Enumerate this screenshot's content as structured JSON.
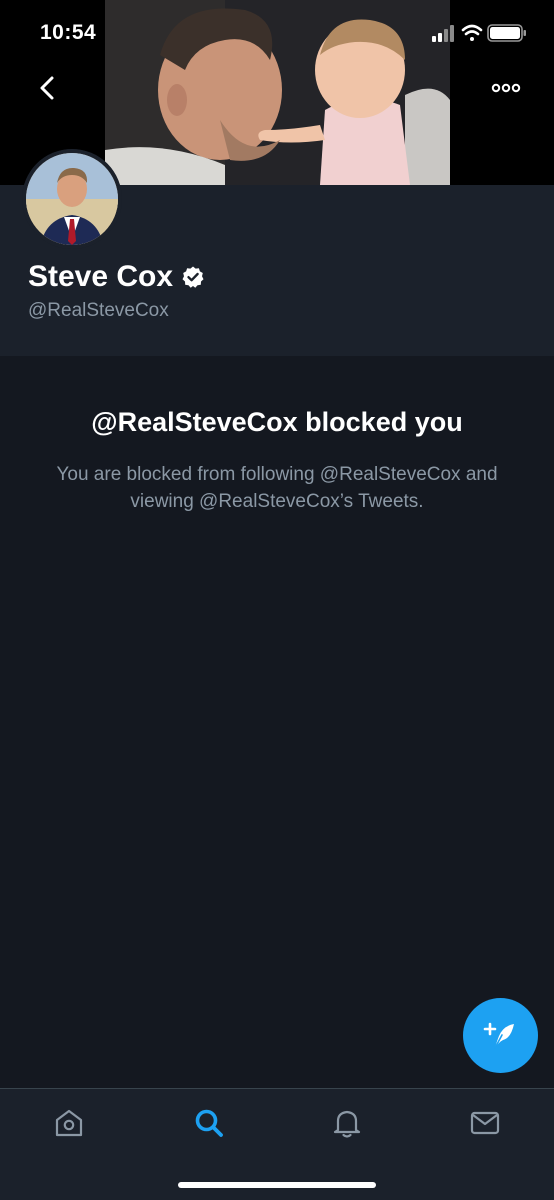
{
  "status_bar": {
    "time": "10:54"
  },
  "header": {
    "back_icon": "chevron-left-icon",
    "more_icon": "more-horizontal-icon"
  },
  "profile": {
    "display_name": "Steve Cox",
    "handle": "@RealSteveCox",
    "verified": true
  },
  "blocked": {
    "title": "@RealSteveCox blocked you",
    "description": "You are blocked from following @RealSteveCox and viewing @RealSteveCox’s Tweets."
  },
  "fab": {
    "icon": "compose-tweet-icon"
  },
  "tabbar": {
    "tabs": [
      {
        "name": "home",
        "icon": "home-icon",
        "active": false
      },
      {
        "name": "search",
        "icon": "search-icon",
        "active": true
      },
      {
        "name": "notifications",
        "icon": "bell-icon",
        "active": false
      },
      {
        "name": "messages",
        "icon": "mail-icon",
        "active": false
      }
    ]
  },
  "colors": {
    "accent": "#1da1f2",
    "background": "#141820",
    "surface": "#1b212b",
    "secondary_text": "#8b98a5"
  }
}
